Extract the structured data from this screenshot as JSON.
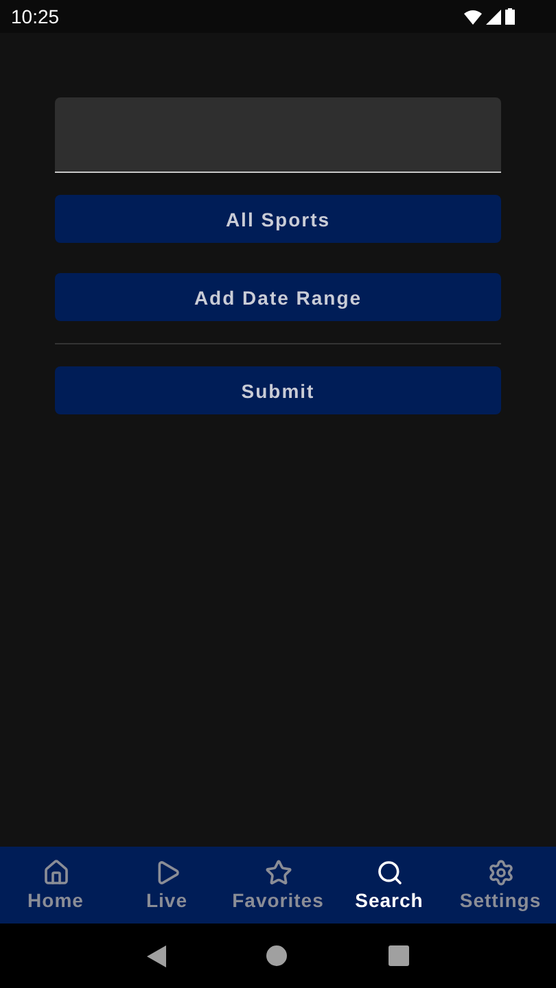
{
  "status_bar": {
    "time": "10:25"
  },
  "buttons": [
    {
      "label": "All Sports"
    },
    {
      "label": "Add Date Range"
    }
  ],
  "submit": {
    "label": "Submit"
  },
  "bottom_nav": [
    {
      "kind": "home",
      "label": "Home",
      "selected": false
    },
    {
      "kind": "live",
      "label": "Live",
      "selected": false
    },
    {
      "kind": "favorites",
      "label": "Favorites",
      "selected": false
    },
    {
      "kind": "search",
      "label": "Search",
      "selected": true
    },
    {
      "kind": "settings",
      "label": "Settings",
      "selected": false
    }
  ]
}
